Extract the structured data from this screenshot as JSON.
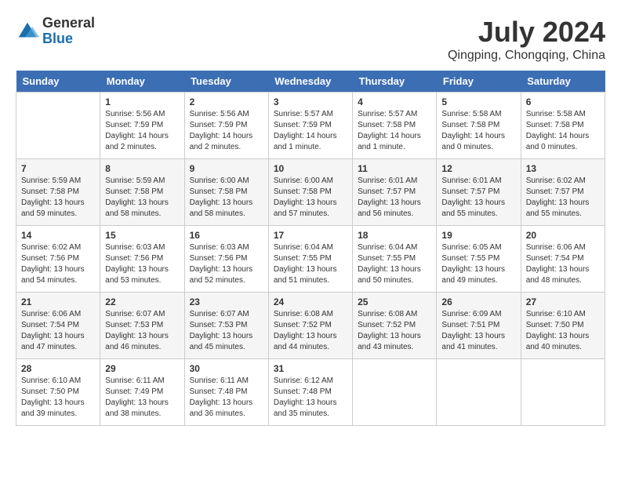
{
  "header": {
    "logo_general": "General",
    "logo_blue": "Blue",
    "title": "July 2024",
    "subtitle": "Qingping, Chongqing, China"
  },
  "days_of_week": [
    "Sunday",
    "Monday",
    "Tuesday",
    "Wednesday",
    "Thursday",
    "Friday",
    "Saturday"
  ],
  "weeks": [
    [
      {
        "day": "",
        "info": ""
      },
      {
        "day": "1",
        "info": "Sunrise: 5:56 AM\nSunset: 7:59 PM\nDaylight: 14 hours\nand 2 minutes."
      },
      {
        "day": "2",
        "info": "Sunrise: 5:56 AM\nSunset: 7:59 PM\nDaylight: 14 hours\nand 2 minutes."
      },
      {
        "day": "3",
        "info": "Sunrise: 5:57 AM\nSunset: 7:59 PM\nDaylight: 14 hours\nand 1 minute."
      },
      {
        "day": "4",
        "info": "Sunrise: 5:57 AM\nSunset: 7:58 PM\nDaylight: 14 hours\nand 1 minute."
      },
      {
        "day": "5",
        "info": "Sunrise: 5:58 AM\nSunset: 7:58 PM\nDaylight: 14 hours\nand 0 minutes."
      },
      {
        "day": "6",
        "info": "Sunrise: 5:58 AM\nSunset: 7:58 PM\nDaylight: 14 hours\nand 0 minutes."
      }
    ],
    [
      {
        "day": "7",
        "info": "Sunrise: 5:59 AM\nSunset: 7:58 PM\nDaylight: 13 hours\nand 59 minutes."
      },
      {
        "day": "8",
        "info": "Sunrise: 5:59 AM\nSunset: 7:58 PM\nDaylight: 13 hours\nand 58 minutes."
      },
      {
        "day": "9",
        "info": "Sunrise: 6:00 AM\nSunset: 7:58 PM\nDaylight: 13 hours\nand 58 minutes."
      },
      {
        "day": "10",
        "info": "Sunrise: 6:00 AM\nSunset: 7:58 PM\nDaylight: 13 hours\nand 57 minutes."
      },
      {
        "day": "11",
        "info": "Sunrise: 6:01 AM\nSunset: 7:57 PM\nDaylight: 13 hours\nand 56 minutes."
      },
      {
        "day": "12",
        "info": "Sunrise: 6:01 AM\nSunset: 7:57 PM\nDaylight: 13 hours\nand 55 minutes."
      },
      {
        "day": "13",
        "info": "Sunrise: 6:02 AM\nSunset: 7:57 PM\nDaylight: 13 hours\nand 55 minutes."
      }
    ],
    [
      {
        "day": "14",
        "info": "Sunrise: 6:02 AM\nSunset: 7:56 PM\nDaylight: 13 hours\nand 54 minutes."
      },
      {
        "day": "15",
        "info": "Sunrise: 6:03 AM\nSunset: 7:56 PM\nDaylight: 13 hours\nand 53 minutes."
      },
      {
        "day": "16",
        "info": "Sunrise: 6:03 AM\nSunset: 7:56 PM\nDaylight: 13 hours\nand 52 minutes."
      },
      {
        "day": "17",
        "info": "Sunrise: 6:04 AM\nSunset: 7:55 PM\nDaylight: 13 hours\nand 51 minutes."
      },
      {
        "day": "18",
        "info": "Sunrise: 6:04 AM\nSunset: 7:55 PM\nDaylight: 13 hours\nand 50 minutes."
      },
      {
        "day": "19",
        "info": "Sunrise: 6:05 AM\nSunset: 7:55 PM\nDaylight: 13 hours\nand 49 minutes."
      },
      {
        "day": "20",
        "info": "Sunrise: 6:06 AM\nSunset: 7:54 PM\nDaylight: 13 hours\nand 48 minutes."
      }
    ],
    [
      {
        "day": "21",
        "info": "Sunrise: 6:06 AM\nSunset: 7:54 PM\nDaylight: 13 hours\nand 47 minutes."
      },
      {
        "day": "22",
        "info": "Sunrise: 6:07 AM\nSunset: 7:53 PM\nDaylight: 13 hours\nand 46 minutes."
      },
      {
        "day": "23",
        "info": "Sunrise: 6:07 AM\nSunset: 7:53 PM\nDaylight: 13 hours\nand 45 minutes."
      },
      {
        "day": "24",
        "info": "Sunrise: 6:08 AM\nSunset: 7:52 PM\nDaylight: 13 hours\nand 44 minutes."
      },
      {
        "day": "25",
        "info": "Sunrise: 6:08 AM\nSunset: 7:52 PM\nDaylight: 13 hours\nand 43 minutes."
      },
      {
        "day": "26",
        "info": "Sunrise: 6:09 AM\nSunset: 7:51 PM\nDaylight: 13 hours\nand 41 minutes."
      },
      {
        "day": "27",
        "info": "Sunrise: 6:10 AM\nSunset: 7:50 PM\nDaylight: 13 hours\nand 40 minutes."
      }
    ],
    [
      {
        "day": "28",
        "info": "Sunrise: 6:10 AM\nSunset: 7:50 PM\nDaylight: 13 hours\nand 39 minutes."
      },
      {
        "day": "29",
        "info": "Sunrise: 6:11 AM\nSunset: 7:49 PM\nDaylight: 13 hours\nand 38 minutes."
      },
      {
        "day": "30",
        "info": "Sunrise: 6:11 AM\nSunset: 7:48 PM\nDaylight: 13 hours\nand 36 minutes."
      },
      {
        "day": "31",
        "info": "Sunrise: 6:12 AM\nSunset: 7:48 PM\nDaylight: 13 hours\nand 35 minutes."
      },
      {
        "day": "",
        "info": ""
      },
      {
        "day": "",
        "info": ""
      },
      {
        "day": "",
        "info": ""
      }
    ]
  ]
}
